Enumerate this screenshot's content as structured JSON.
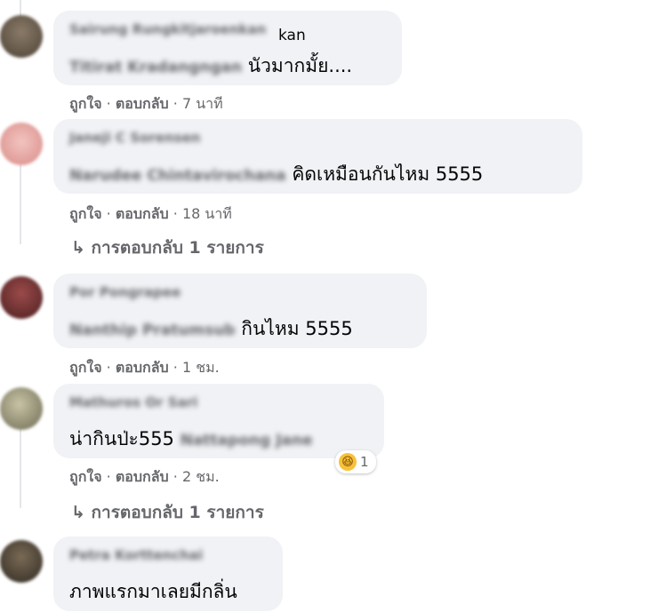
{
  "comments": [
    {
      "author": "Sairung Rungkitjaroenkan",
      "author_tail": "kan",
      "text_hidden": "Titirat Kradangngan",
      "text": "นัวมากมั้ย....",
      "like": "ถูกใจ",
      "reply": "ตอบกลับ",
      "time": "7 นาที"
    },
    {
      "author": "Janeji C Sorensen",
      "text_hidden": "Narudee Chintavirochana",
      "text": "คิดเหมือนกันไหม 5555",
      "like": "ถูกใจ",
      "reply": "ตอบกลับ",
      "time": "18 นาที",
      "replies_link": "การตอบกลับ 1 รายการ"
    },
    {
      "author": "Por Pongrapee",
      "text_hidden": "Nanthip Pratumsub",
      "text": "กินไหม 5555",
      "like": "ถูกใจ",
      "reply": "ตอบกลับ",
      "time": "1 ชม."
    },
    {
      "author": "Mathuros Or Sari",
      "text": "น่ากินป่ะ555",
      "text_hidden": "Nattapong Jane",
      "like": "ถูกใจ",
      "reply": "ตอบกลับ",
      "time": "2 ชม.",
      "reaction_count": "1",
      "replies_link": "การตอบกลับ 1 รายการ"
    },
    {
      "author": "Petra Korttenchai",
      "text": "ภาพแรกมาเลยมีกลิ่น"
    }
  ],
  "separator": "·",
  "reply_arrow": "↳",
  "colors": {
    "bubble": "#f0f2f5",
    "meta_text": "#65676b",
    "body_text": "#050505",
    "reaction": "#f7c13a"
  },
  "icons": [
    "haha-reaction-icon",
    "reply-arrow-icon"
  ]
}
